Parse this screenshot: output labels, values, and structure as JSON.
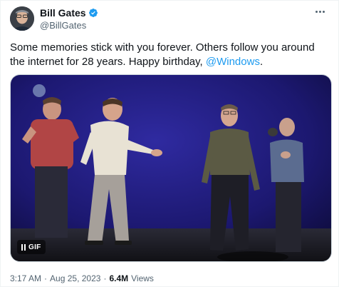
{
  "author": {
    "display_name": "Bill Gates",
    "handle": "@BillGates",
    "verified": true,
    "verified_icon": "verified-badge-icon",
    "avatar_icon": "avatar"
  },
  "tweet": {
    "text_main": "Some memories stick with you forever. Others follow you around the internet for 28 years. Happy birthday, ",
    "mention": "@Windows",
    "text_end": "."
  },
  "media": {
    "type": "GIF",
    "badge_label": "GIF",
    "state_icon": "pause-icon"
  },
  "meta": {
    "time": "3:17 AM",
    "separator": "·",
    "date": "Aug 25, 2023",
    "views_count": "6.4M",
    "views_label": "Views"
  },
  "colors": {
    "accent": "#1d9bf0",
    "text": "#0f1419",
    "secondary": "#536471",
    "stage_background": "#1e1b6b"
  }
}
